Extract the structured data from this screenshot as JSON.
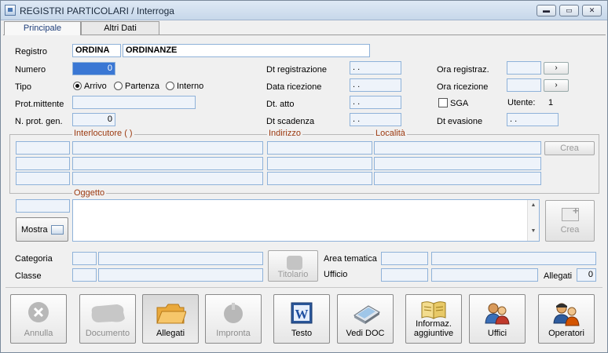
{
  "window": {
    "title": "REGISTRI PARTICOLARI / Interroga"
  },
  "tabs": [
    {
      "label": "Principale"
    },
    {
      "label": "Altri Dati"
    }
  ],
  "left": {
    "registro_label": "Registro",
    "registro_code": "ORDINA",
    "registro_desc": "ORDINANZE",
    "numero_label": "Numero",
    "numero_value": "0",
    "tipo_label": "Tipo",
    "tipo_options": [
      "Arrivo",
      "Partenza",
      "Interno"
    ],
    "tipo_selected": "Arrivo",
    "prot_mittente_label": "Prot.mittente",
    "nprot_label": "N. prot. gen.",
    "nprot_value": "0"
  },
  "middle": {
    "dt_registrazione_label": "Dt registrazione",
    "dt_registrazione_value": ". .",
    "data_ricezione_label": "Data ricezione",
    "data_ricezione_value": ". .",
    "dt_atto_label": "Dt. atto",
    "dt_atto_value": ". .",
    "dt_scadenza_label": "Dt scadenza",
    "dt_scadenza_value": ". ."
  },
  "right": {
    "ora_registraz_label": "Ora registraz.",
    "ora_ricezione_label": "Ora ricezione",
    "time_button_label": "›",
    "sga_label": "SGA",
    "utente_label": "Utente:",
    "utente_value": "1",
    "dt_evasione_label": "Dt evasione",
    "dt_evasione_value": ". ."
  },
  "interlocutori": {
    "label": "Interlocutore  (     )",
    "indirizzo_label": "Indirizzo",
    "localita_label": "Località",
    "crea_label": "Crea"
  },
  "oggetto": {
    "label": "Oggetto",
    "mostra_label": "Mostra",
    "crea_label": "Crea",
    "scroll_up": "▲",
    "scroll_down": "▼"
  },
  "classification": {
    "categoria_label": "Categoria",
    "classe_label": "Classe",
    "titolario_label": "Titolario",
    "area_tematica_label": "Area tematica",
    "ufficio_label": "Ufficio",
    "allegati_label": "Allegati",
    "allegati_value": "0"
  },
  "toolbar": {
    "annulla": "Annulla",
    "documento": "Documento",
    "allegati": "Allegati",
    "impronta": "Impronta",
    "testo": "Testo",
    "vedi_doc": "Vedi DOC",
    "informaz_line1": "Informaz.",
    "informaz_line2": "aggiuntive",
    "uffici": "Uffici",
    "operatori": "Operatori"
  },
  "colors": {
    "field_border": "#8fb2d9",
    "field_bg": "#eef3fa",
    "group_label": "#9c3a10",
    "focus": "#3a77d4"
  }
}
